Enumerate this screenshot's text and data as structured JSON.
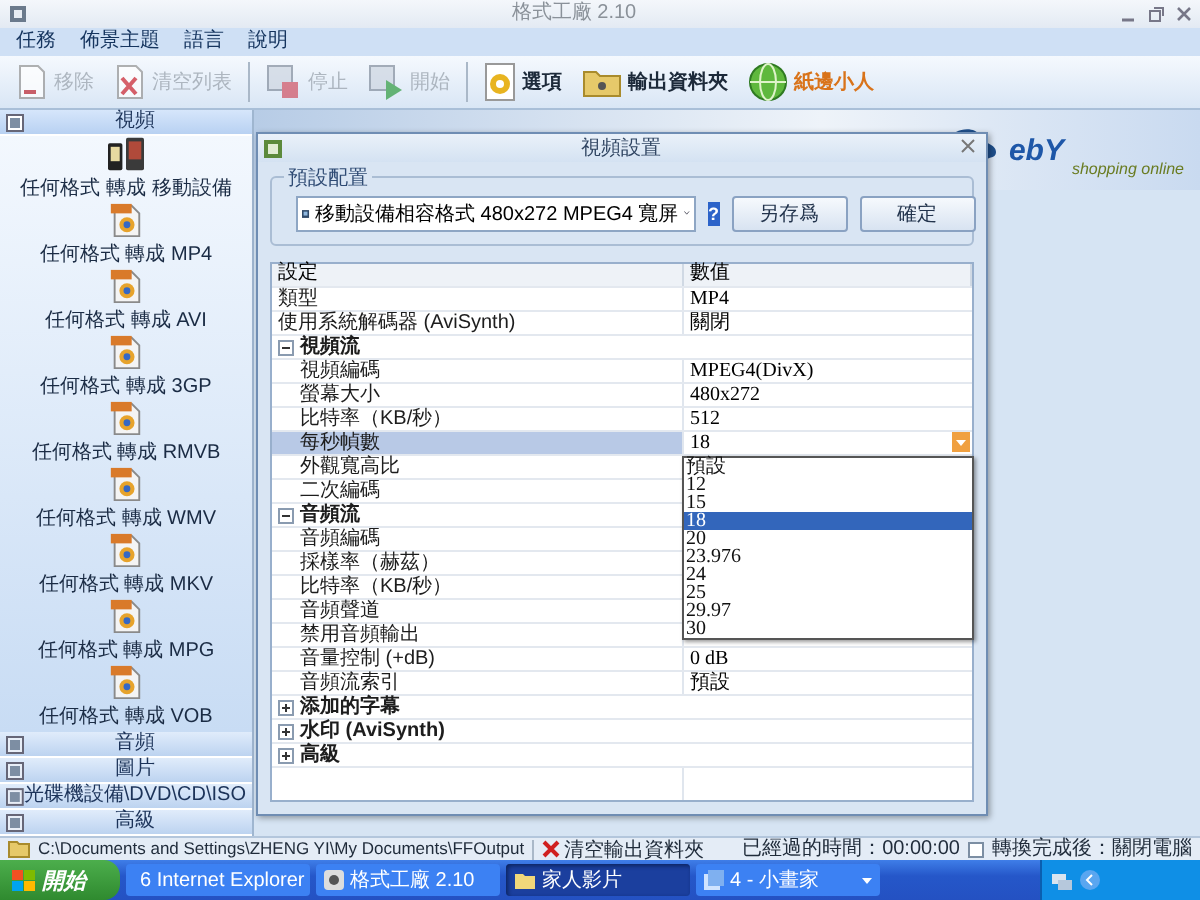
{
  "window": {
    "title": "格式工廠 2.10"
  },
  "menu": [
    "任務",
    "佈景主題",
    "語言",
    "說明"
  ],
  "toolbar": [
    {
      "label": "移除",
      "disabled": true,
      "kind": "button"
    },
    {
      "label": "清空列表",
      "disabled": true,
      "kind": "button"
    },
    {
      "label": "停止",
      "disabled": true,
      "kind": "button"
    },
    {
      "label": "開始",
      "disabled": true,
      "kind": "button"
    },
    {
      "label": "選項",
      "disabled": false,
      "kind": "button"
    },
    {
      "label": "輸出資料夾",
      "disabled": false,
      "kind": "button"
    },
    {
      "label": "紙邊小人",
      "disabled": false,
      "kind": "link"
    }
  ],
  "banner": {
    "ad_logo": "ebY",
    "ad_tagline": "shopping online"
  },
  "sidebar": {
    "sections": [
      {
        "title": "視頻",
        "expanded": true,
        "items": [
          {
            "label": "任何格式 轉成 移動設備",
            "kind": "device"
          },
          {
            "label": "任何格式 轉成 MP4",
            "kind": "file"
          },
          {
            "label": "任何格式 轉成 AVI",
            "kind": "file"
          },
          {
            "label": "任何格式 轉成 3GP",
            "kind": "file"
          },
          {
            "label": "任何格式 轉成 RMVB",
            "kind": "file"
          },
          {
            "label": "任何格式 轉成 WMV",
            "kind": "file"
          },
          {
            "label": "任何格式 轉成 MKV",
            "kind": "file"
          },
          {
            "label": "任何格式 轉成 MPG",
            "kind": "file"
          },
          {
            "label": "任何格式 轉成 VOB",
            "kind": "file"
          }
        ]
      },
      {
        "title": "音頻",
        "expanded": false
      },
      {
        "title": "圖片",
        "expanded": false
      },
      {
        "title": "光碟機設備\\DVD\\CD\\ISO",
        "expanded": false
      },
      {
        "title": "高級",
        "expanded": false
      }
    ]
  },
  "dialog": {
    "title": "視頻設置",
    "preset_group": "預設配置",
    "preset_value": "移動設備相容格式 480x272 MPEG4 寬屏",
    "help_label": "?",
    "buttons": [
      "另存爲",
      "確定"
    ],
    "grid": {
      "columns": [
        "設定",
        "數值"
      ],
      "rows": [
        {
          "kind": "row",
          "name": "類型",
          "value": "MP4",
          "selected": false
        },
        {
          "kind": "row",
          "name": "使用系統解碼器 (AviSynth)",
          "value": "關閉",
          "selected": false
        },
        {
          "kind": "category",
          "name": "視頻流",
          "expanded": true,
          "children": [
            {
              "kind": "row",
              "name": "視頻編碼",
              "value": "MPEG4(DivX)",
              "selected": false
            },
            {
              "kind": "row",
              "name": "螢幕大小",
              "value": "480x272",
              "selected": false
            },
            {
              "kind": "row",
              "name": "比特率（KB/秒）",
              "value": "512",
              "selected": false
            },
            {
              "kind": "row",
              "name": "每秒幀數",
              "value": "18",
              "selected": true,
              "dropdown": [
                {
                  "label": "預設",
                  "selected": false
                },
                {
                  "label": "12",
                  "selected": false
                },
                {
                  "label": "15",
                  "selected": false
                },
                {
                  "label": "18",
                  "selected": true
                },
                {
                  "label": "20",
                  "selected": false
                },
                {
                  "label": "23.976",
                  "selected": false
                },
                {
                  "label": "24",
                  "selected": false
                },
                {
                  "label": "25",
                  "selected": false
                },
                {
                  "label": "29.97",
                  "selected": false
                },
                {
                  "label": "30",
                  "selected": false
                }
              ]
            },
            {
              "kind": "row",
              "name": "外觀寬高比",
              "selected": false
            },
            {
              "kind": "row",
              "name": "二次編碼",
              "selected": false
            }
          ]
        },
        {
          "kind": "category",
          "name": "音頻流",
          "expanded": true,
          "children": [
            {
              "kind": "row",
              "name": "音頻編碼",
              "selected": false
            },
            {
              "kind": "row",
              "name": "採樣率（赫茲）",
              "selected": false
            },
            {
              "kind": "row",
              "name": "比特率（KB/秒）",
              "selected": false
            },
            {
              "kind": "row",
              "name": "音頻聲道",
              "selected": false
            },
            {
              "kind": "row",
              "name": "禁用音頻輸出",
              "selected": false
            },
            {
              "kind": "row",
              "name": "音量控制 (+dB)",
              "value": "0 dB",
              "selected": false
            },
            {
              "kind": "row",
              "name": "音頻流索引",
              "value": "預設",
              "selected": false
            }
          ]
        },
        {
          "kind": "category",
          "name": "添加的字幕",
          "expanded": false
        },
        {
          "kind": "category",
          "name": "水印 (AviSynth)",
          "expanded": false
        },
        {
          "kind": "category",
          "name": "高級",
          "expanded": false
        }
      ]
    }
  },
  "status_bar": {
    "path": "C:\\Documents and Settings\\ZHENG YI\\My Documents\\FFOutput",
    "clear_label": "清空輸出資料夾",
    "elapsed": "已經過的時間：00:00:00",
    "shutdown_label": "轉換完成後：關閉電腦",
    "shutdown_checked": false
  },
  "taskbar": {
    "start": "開始",
    "items": [
      {
        "label": "6 Internet Explorer",
        "selected": false,
        "kind": "group"
      },
      {
        "label": "格式工廠 2.10",
        "selected": false,
        "kind": "app"
      },
      {
        "label": "家人影片",
        "selected": true,
        "kind": "folder"
      },
      {
        "label": "4 - 小畫家",
        "selected": false,
        "kind": "group"
      }
    ]
  }
}
